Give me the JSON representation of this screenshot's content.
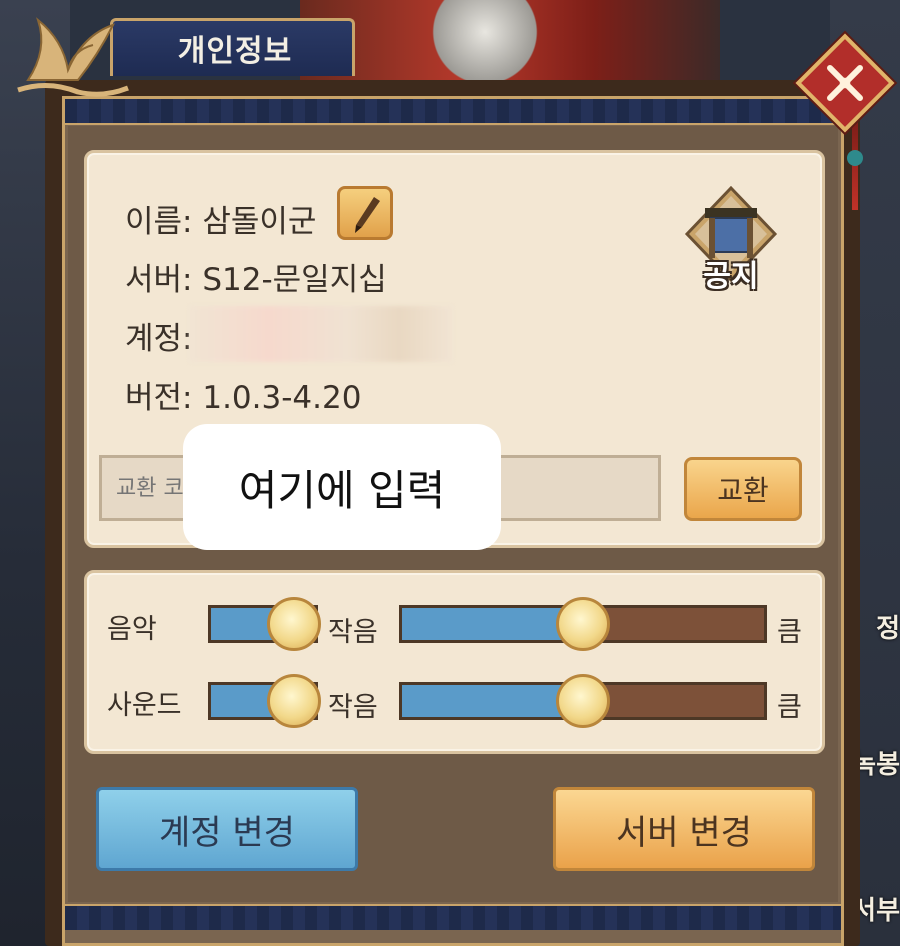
{
  "window": {
    "title": "개인정보"
  },
  "profile": {
    "name_label": "이름:",
    "name_value": "삼돌이군",
    "server_label": "서버:",
    "server_value": "S12-문일지십",
    "account_label": "계정:",
    "version_label": "버전:",
    "version_value": "1.0.3-4.20"
  },
  "notice": {
    "label": "공지",
    "icon": "notice-board-icon"
  },
  "redeem": {
    "placeholder": "교환 코드를 입력하십시오.",
    "button_label": "교환",
    "overlay_text": "여기에 입력"
  },
  "sound": {
    "rows": [
      {
        "label": "음악",
        "toggle_label": "작음",
        "max_label": "큼",
        "level": 0.5
      },
      {
        "label": "사운드",
        "toggle_label": "작음",
        "max_label": "큼",
        "level": 0.5
      }
    ]
  },
  "buttons": {
    "account_change": "계정 변경",
    "server_change": "서버 변경"
  },
  "side_menu": {
    "item_1": "정",
    "item_2": "녹봉",
    "item_3": "서부"
  },
  "colors": {
    "panel_bg": "#f3e7d3",
    "slider_fill": "#5a9bc9",
    "slider_empty": "#7d5139",
    "account_button": "#8fd0ea",
    "server_button": "#eaa24a",
    "close_button": "#b22e2a"
  }
}
